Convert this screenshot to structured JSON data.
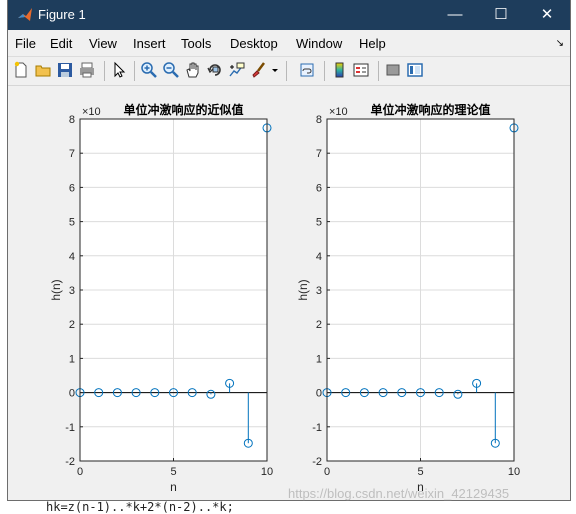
{
  "window": {
    "title": "Figure 1",
    "buttons": {
      "minimize": "—",
      "maximize": "☐",
      "close": "✕"
    }
  },
  "menu": {
    "items": [
      "File",
      "Edit",
      "View",
      "Insert",
      "Tools",
      "Desktop",
      "Window",
      "Help"
    ],
    "overflow": "↘"
  },
  "toolbar": {
    "icons": [
      "new-figure-icon",
      "open-file-icon",
      "save-icon",
      "print-icon",
      "select-arrow-icon",
      "zoom-in-icon",
      "zoom-out-icon",
      "pan-hand-icon",
      "rotate-3d-icon",
      "data-cursor-icon",
      "brush-icon",
      "brush-dropdown-icon",
      "link-plot-icon",
      "colorbar-icon",
      "legend-icon",
      "hide-plot-tools-icon",
      "show-plot-tools-icon"
    ]
  },
  "background": {
    "code_line": "hk=z(n-1)..*k+2*(n-2)..*k;"
  },
  "watermark": "https://blog.csdn.net/weixin_42129435",
  "colors": {
    "stem": "#0072bd",
    "titlebar": "#1e3d5c",
    "grid": "#dcdcdc"
  },
  "chart_data": [
    {
      "type": "stem",
      "title": "单位冲激响应的近似值",
      "xlabel": "n",
      "ylabel": "h(n)",
      "exponent_label": "×10",
      "x": [
        0,
        1,
        2,
        3,
        4,
        5,
        6,
        7,
        8,
        9,
        10
      ],
      "y": [
        0,
        0,
        0,
        0,
        0,
        0,
        0,
        -0.05,
        0.27,
        -1.48,
        7.74
      ],
      "xlim": [
        0,
        10
      ],
      "ylim": [
        -2,
        8
      ],
      "xticks": [
        0,
        5,
        10
      ],
      "yticks": [
        -2,
        -1,
        0,
        1,
        2,
        3,
        4,
        5,
        6,
        7,
        8
      ],
      "grid": true
    },
    {
      "type": "stem",
      "title": "单位冲激响应的理论值",
      "xlabel": "n",
      "ylabel": "h(n)",
      "exponent_label": "×10",
      "x": [
        0,
        1,
        2,
        3,
        4,
        5,
        6,
        7,
        8,
        9,
        10
      ],
      "y": [
        0,
        0,
        0,
        0,
        0,
        0,
        0,
        -0.05,
        0.27,
        -1.48,
        7.74
      ],
      "xlim": [
        0,
        10
      ],
      "ylim": [
        -2,
        8
      ],
      "xticks": [
        0,
        5,
        10
      ],
      "yticks": [
        -2,
        -1,
        0,
        1,
        2,
        3,
        4,
        5,
        6,
        7,
        8
      ],
      "grid": true
    }
  ]
}
